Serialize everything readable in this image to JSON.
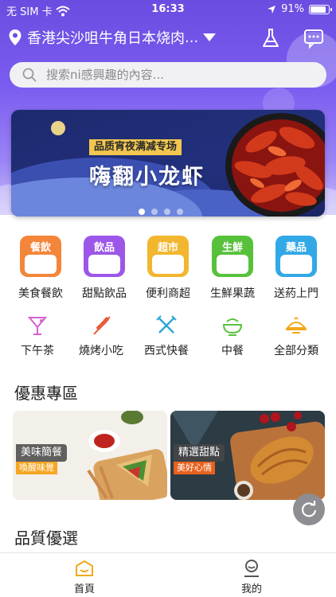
{
  "status_bar": {
    "carrier": "无 SIM 卡",
    "time": "16:33",
    "battery": "91%",
    "battery_level": 0.91
  },
  "header": {
    "location": "香港尖沙咀牛角日本烧肉",
    "location_ellipsis": "..."
  },
  "search": {
    "placeholder": "搜索ni感興趣的內容..."
  },
  "banner": {
    "tag": "品质宵夜满减专场",
    "title": "嗨翻小龙虾",
    "slide_count": 4,
    "active_slide": 0
  },
  "categories_primary": [
    {
      "badge": "餐飲",
      "label": "美食餐飲",
      "color": "#f3863a"
    },
    {
      "badge": "飲品",
      "label": "甜點飲品",
      "color": "#9c57e8"
    },
    {
      "badge": "超市",
      "label": "便利商超",
      "color": "#f2b62f"
    },
    {
      "badge": "生鮮",
      "label": "生鮮果蔬",
      "color": "#58c13b"
    },
    {
      "badge": "藥品",
      "label": "送葯上門",
      "color": "#33a8e6"
    }
  ],
  "categories_secondary": [
    {
      "label": "下午茶",
      "icon": "cocktail-icon"
    },
    {
      "label": "燒烤小吃",
      "icon": "skewer-icon"
    },
    {
      "label": "西式快餐",
      "icon": "fork-knife-icon"
    },
    {
      "label": "中餐",
      "icon": "bowl-icon"
    },
    {
      "label": "全部分類",
      "icon": "dish-icon"
    }
  ],
  "sections": {
    "promo_title": "優惠專區",
    "quality_title": "品質優選"
  },
  "promos": [
    {
      "title": "美味簡餐",
      "subtitle": "喚醒味覺"
    },
    {
      "title": "精選甜點",
      "subtitle": "美好心情"
    }
  ],
  "tabbar": {
    "home": "首頁",
    "me": "我的"
  },
  "colors": {
    "brand_purple": "#6a4de0",
    "accent_yellow": "#f3c74f"
  }
}
